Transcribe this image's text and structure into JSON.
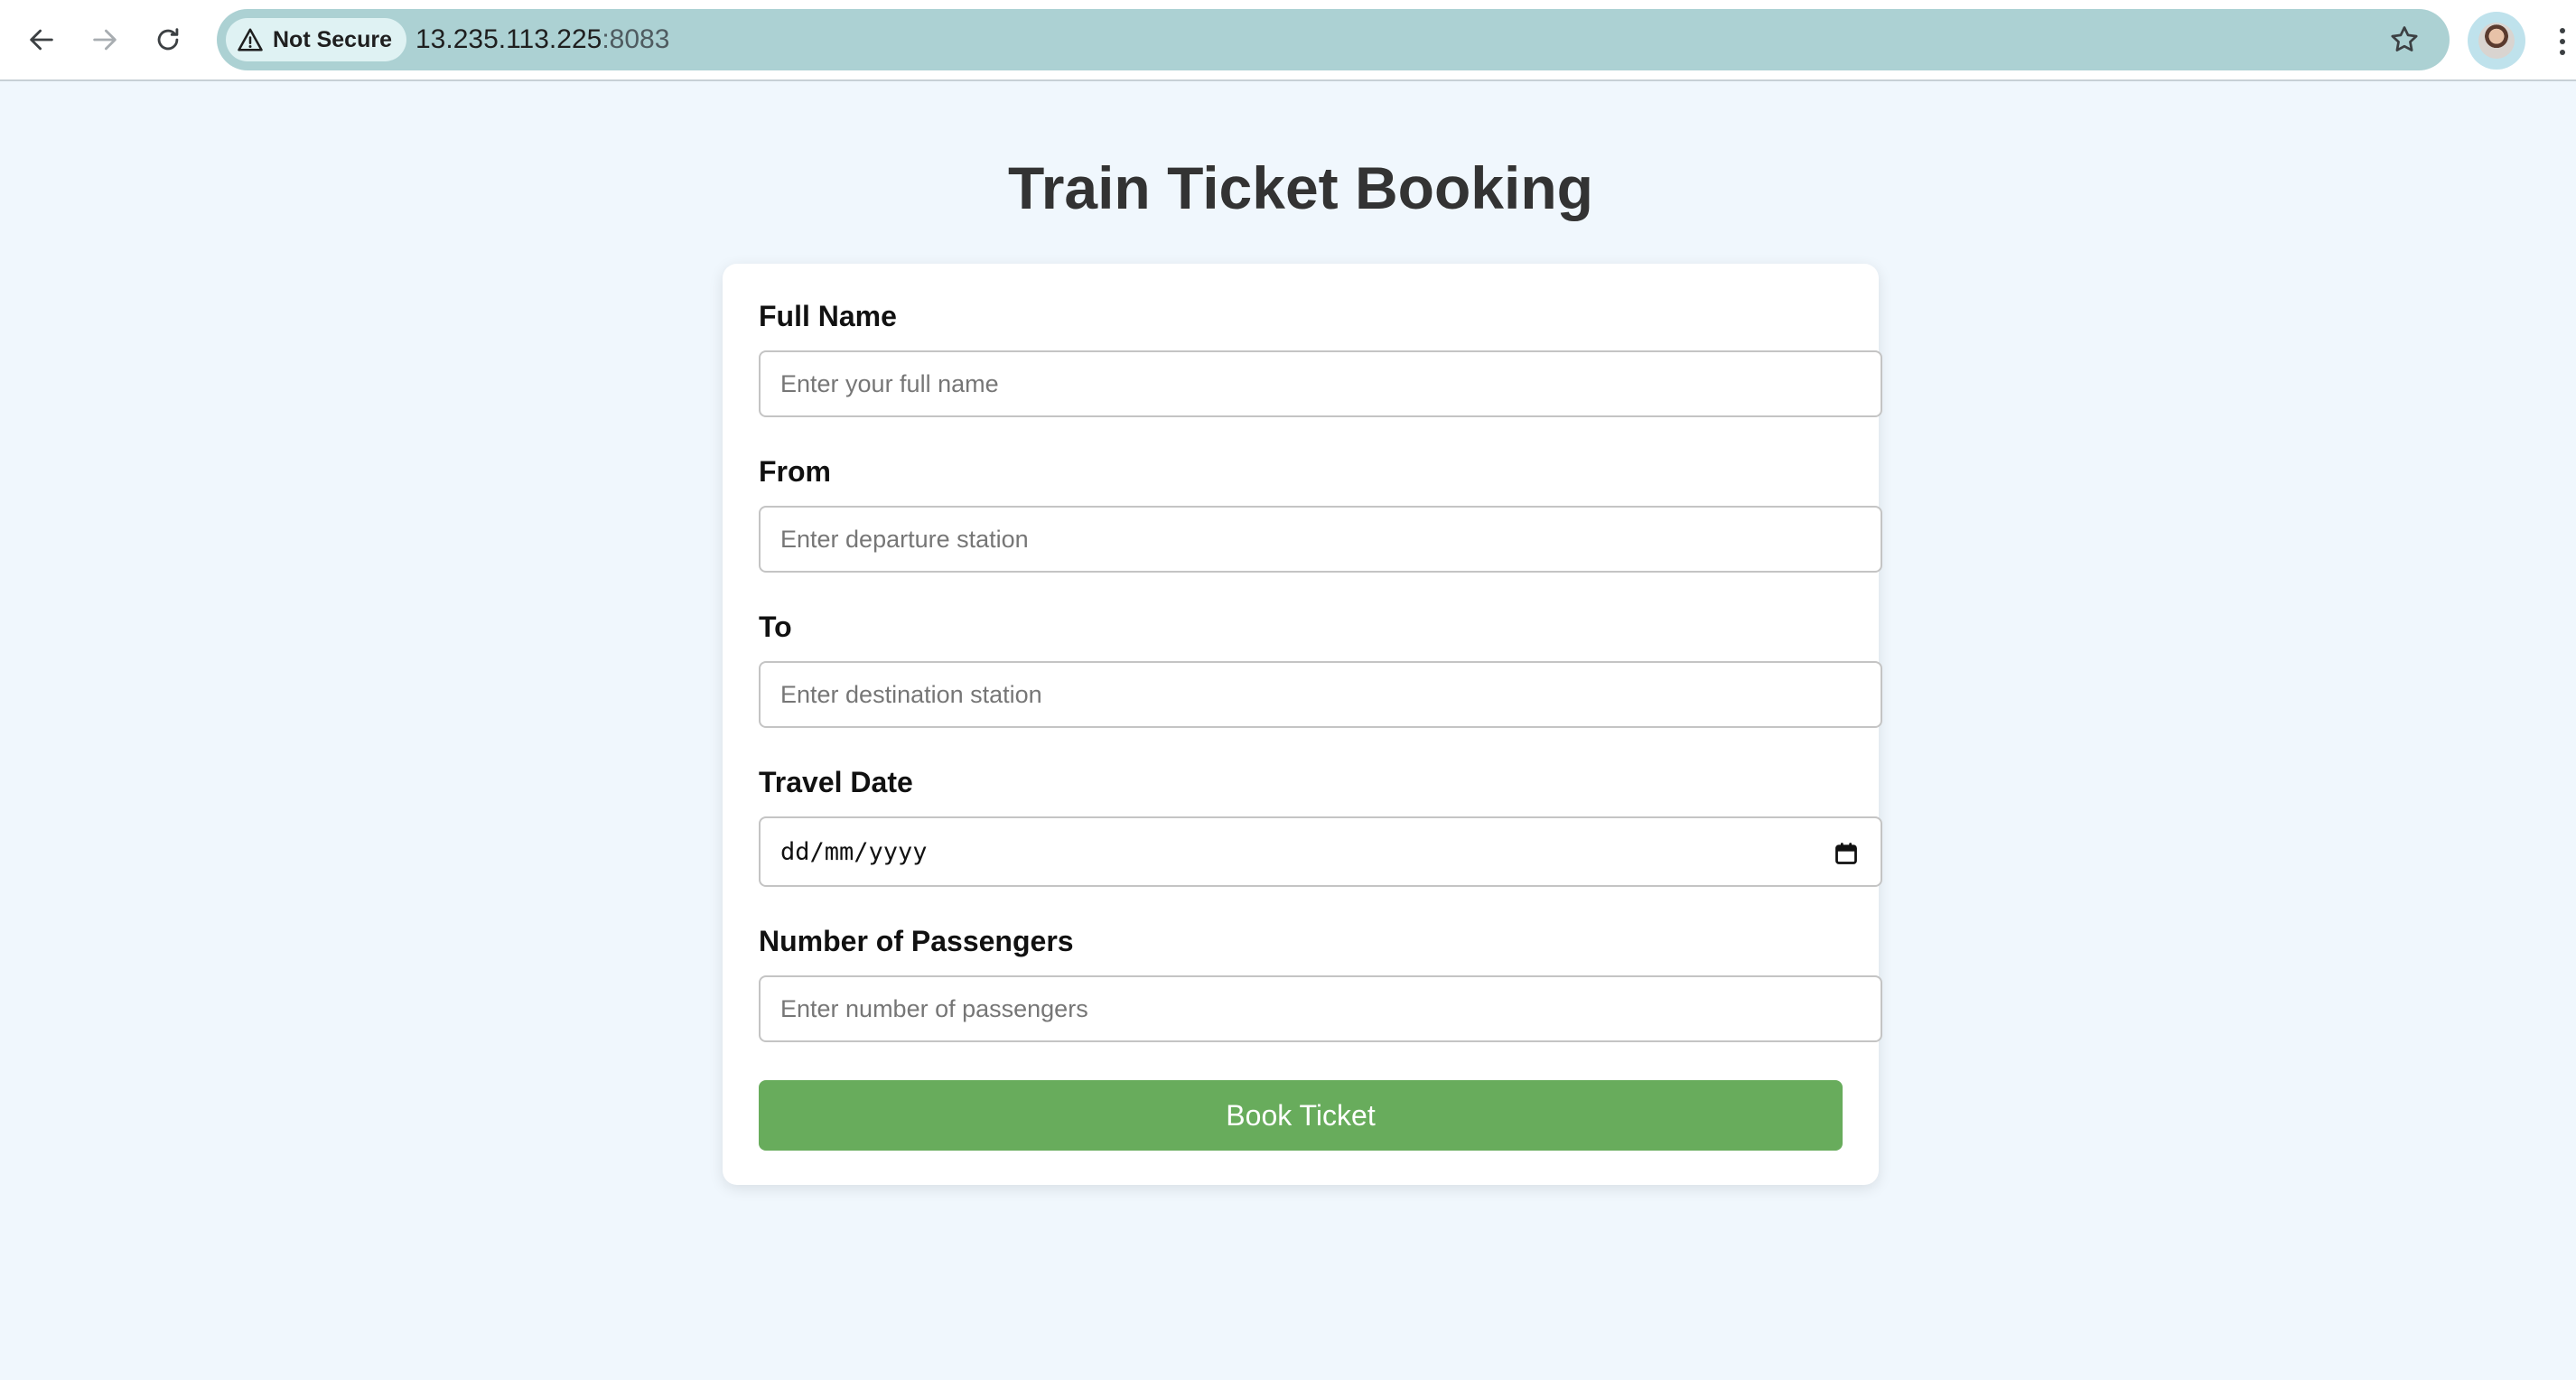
{
  "browser": {
    "security_label": "Not Secure",
    "url_host": "13.235.113.225",
    "url_port": ":8083",
    "icons": {
      "back": "back-arrow-icon",
      "forward": "forward-arrow-icon",
      "reload": "reload-icon",
      "warning": "warning-icon",
      "bookmark": "star-icon",
      "profile": "avatar",
      "menu": "kebab-menu-icon"
    }
  },
  "page": {
    "title": "Train Ticket Booking"
  },
  "form": {
    "full_name": {
      "label": "Full Name",
      "placeholder": "Enter your full name",
      "value": ""
    },
    "from": {
      "label": "From",
      "placeholder": "Enter departure station",
      "value": ""
    },
    "to": {
      "label": "To",
      "placeholder": "Enter destination station",
      "value": ""
    },
    "travel_date": {
      "label": "Travel Date",
      "display": "dd/mm/yyyy"
    },
    "passengers": {
      "label": "Number of Passengers",
      "placeholder": "Enter number of passengers",
      "value": ""
    },
    "submit_label": "Book Ticket"
  },
  "colors": {
    "page_background": "#f0f7fd",
    "omnibox": "#acd1d3",
    "button": "#68ac5c",
    "title_text": "#333333"
  }
}
